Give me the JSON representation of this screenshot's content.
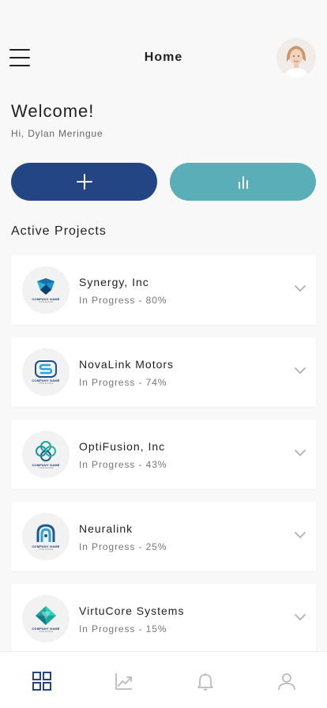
{
  "header": {
    "title": "Home",
    "menu_icon": "hamburger-menu-icon",
    "avatar": "user-avatar"
  },
  "welcome": {
    "title": "Welcome!",
    "greeting": "Hi, Dylan Meringue"
  },
  "actions": {
    "add_icon": "plus-icon",
    "stats_icon": "bar-chart-icon",
    "add_color": "#234584",
    "stats_color": "#5aaeb7"
  },
  "projects": {
    "section_title": "Active Projects",
    "items": [
      {
        "name": "Synergy, Inc",
        "status": "In Progress - 80%",
        "progress": 80,
        "logo_text": "COMPANY NAME",
        "logo_sub": "YOUR SLOGAN",
        "icon": "gem-logo-icon"
      },
      {
        "name": "NovaLink Motors",
        "status": "In Progress - 74%",
        "progress": 74,
        "logo_text": "COMPANY NAME",
        "logo_sub": "YOUR SLOGAN",
        "icon": "s-letter-logo-icon"
      },
      {
        "name": "OptiFusion, Inc",
        "status": "In Progress - 43%",
        "progress": 43,
        "logo_text": "COMPANY NAME",
        "logo_sub": "YOUR SLOGAN",
        "icon": "knot-logo-icon"
      },
      {
        "name": "Neuralink",
        "status": "In Progress - 25%",
        "progress": 25,
        "logo_text": "COMPANY NAME",
        "logo_sub": "YOUR SLOGAN",
        "icon": "arch-logo-icon"
      },
      {
        "name": "VirtuCore Systems",
        "status": "In Progress - 15%",
        "progress": 15,
        "logo_text": "COMPANY NAME",
        "logo_sub": "YOUR SLOGAN",
        "icon": "diamond-logo-icon"
      }
    ]
  },
  "tabbar": {
    "tabs": [
      "dashboard-grid-icon",
      "trending-chart-icon",
      "bell-icon",
      "user-icon"
    ],
    "active_color": "#234584",
    "inactive_color": "#bbbbbb"
  }
}
